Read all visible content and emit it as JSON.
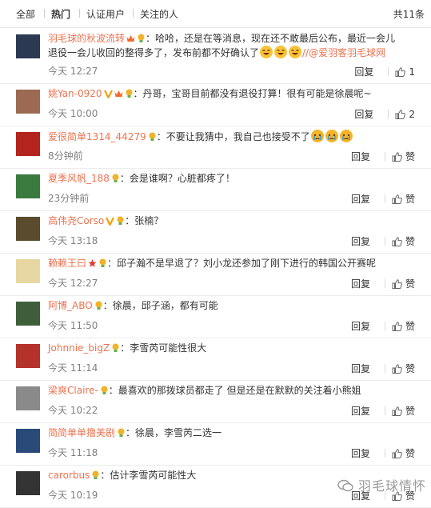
{
  "tabs": [
    "全部",
    "热门",
    "认证用户",
    "关注的人"
  ],
  "total": "共11条",
  "reply_label": "回复",
  "like_label": "赞",
  "comments": [
    {
      "user": "羽毛球的秋波流转",
      "badges": [
        "vip",
        "bulb"
      ],
      "text": "：哈哈，还是在等消息，现在还不敢最后公布，最近一会儿",
      "text2": "退役一会儿收回的整得多了，发布前都不好确认了",
      "emoji2": 3,
      "link": "//@爱羽客羽毛球网",
      "time": "今天 12:27",
      "likes": "1",
      "avatar_color": "#2b3a52"
    },
    {
      "user": "姚Yan-0920",
      "badges": [
        "v",
        "vip",
        "bulb"
      ],
      "text": "：丹哥，宝哥目前都没有退役打算！很有可能是徐晨呢~",
      "time": "今天 10:00",
      "likes": "2",
      "avatar_color": "#9c6a53"
    },
    {
      "user": "爱很简单1314_44279",
      "badges": [
        "bulb"
      ],
      "text": "：不要让我猜中，我自己也接受不了",
      "emoji": 3,
      "time": "8分钟前",
      "likes": "赞",
      "avatar_color": "#b3241e"
    },
    {
      "user": "夏季风帆_188",
      "badges": [
        "bulb"
      ],
      "text": "：会是谁啊？心脏都疼了！",
      "time": "23分钟前",
      "likes": "赞",
      "avatar_color": "#3b7a3f"
    },
    {
      "user": "高伟尧Corso",
      "badges": [
        "v",
        "bulb"
      ],
      "text": "：张楠？",
      "time": "今天 13:18",
      "likes": "赞",
      "avatar_color": "#5a4a2e"
    },
    {
      "user": "赖赖王曰",
      "badges": [
        "star",
        "bulb"
      ],
      "text": "：邱子瀚不是早退了？刘小龙还参加了刚下进行的韩国公开赛呢",
      "time": "今天 12:27",
      "likes": "赞",
      "avatar_color": "#e8d6a2"
    },
    {
      "user": "阿博_ABO",
      "badges": [
        "bulb"
      ],
      "text": "：徐晨，邱子涵，都有可能",
      "time": "今天 11:50",
      "likes": "赞",
      "avatar_color": "#3e5e3a"
    },
    {
      "user": "Johnnie_bigZ",
      "badges": [
        "bulb"
      ],
      "text": "：李雪芮可能性很大",
      "time": "今天 11:14",
      "likes": "赞",
      "avatar_color": "#b5322a"
    },
    {
      "user": "梁爽Claire-",
      "badges": [
        "bulb"
      ],
      "text": "：最喜欢的那拨球员都走了 但是还是在默默的关注着小熊姐",
      "time": "今天 10:22",
      "likes": "赞",
      "avatar_color": "#8a8a8a"
    },
    {
      "user": "简简单单撸美剧",
      "badges": [
        "bulb"
      ],
      "text": "：徐晨，李雪芮二选一",
      "time": "今天 11:18",
      "likes": "赞",
      "avatar_color": "#2a4a7a"
    },
    {
      "user": "carorbus",
      "badges": [
        "bulb"
      ],
      "text": "：估计李雪芮可能性大",
      "time": "今天 10:19",
      "likes": "赞",
      "avatar_color": "#333333"
    }
  ],
  "watermark": "羽毛球情怀"
}
